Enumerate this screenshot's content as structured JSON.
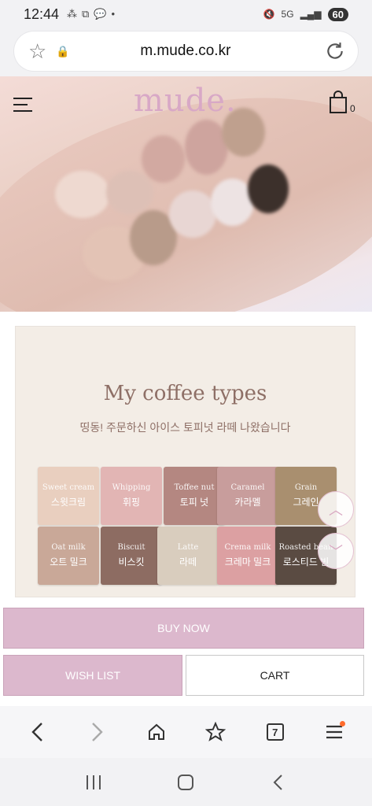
{
  "status_bar": {
    "time": "12:44",
    "left_icons": [
      "grid-icon",
      "screenshot-icon",
      "talk-icon",
      "dot-icon"
    ],
    "network": "5G",
    "battery": "60"
  },
  "browser": {
    "url": "m.mude.co.kr"
  },
  "header": {
    "logo": "mude.",
    "cart_count": "0"
  },
  "product": {
    "title": "My coffee types",
    "subtitle": "띵동! 주문하신 아이스 토피넛 라떼 나왔습니다",
    "shades": [
      {
        "en": "Sweet cream",
        "kr": "스윗크림",
        "color": "#e9cfbf"
      },
      {
        "en": "Whipping",
        "kr": "휘핑",
        "color": "#e2b5b4"
      },
      {
        "en": "Toffee nut",
        "kr": "토피 넛",
        "color": "#b48781"
      },
      {
        "en": "Caramel",
        "kr": "카라멜",
        "color": "#c89d9c"
      },
      {
        "en": "Grain",
        "kr": "그레인",
        "color": "#a98f6f"
      },
      {
        "en": "Oat milk",
        "kr": "오트 밀크",
        "color": "#c9a898"
      },
      {
        "en": "Biscuit",
        "kr": "비스킷",
        "color": "#8d6c62"
      },
      {
        "en": "Latte",
        "kr": "라떼",
        "color": "#d9cdbe"
      },
      {
        "en": "Crema milk",
        "kr": "크레마 밀크",
        "color": "#dca0a2"
      },
      {
        "en": "Roasted bean",
        "kr": "로스티드 빈",
        "color": "#5a4b42"
      }
    ]
  },
  "actions": {
    "buy_now": "BUY NOW",
    "wish_list": "WISH LIST",
    "cart": "CART"
  },
  "toolbar": {
    "tab_count": "7"
  },
  "colors": {
    "accent": "#dcb8cd",
    "logo": "#d8a8c6",
    "text_brown": "#8e6f66"
  }
}
